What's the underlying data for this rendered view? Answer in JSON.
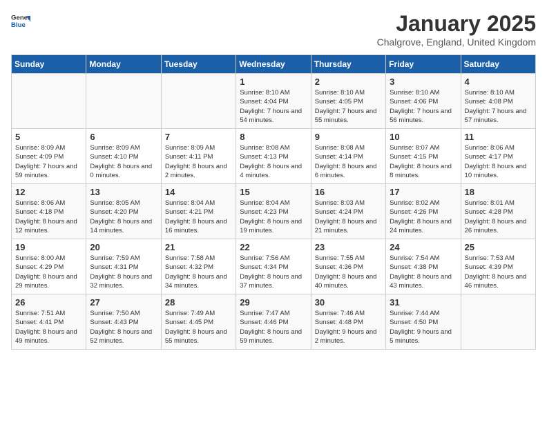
{
  "header": {
    "logo_general": "General",
    "logo_blue": "Blue",
    "month_title": "January 2025",
    "location": "Chalgrove, England, United Kingdom"
  },
  "days_of_week": [
    "Sunday",
    "Monday",
    "Tuesday",
    "Wednesday",
    "Thursday",
    "Friday",
    "Saturday"
  ],
  "weeks": [
    [
      {
        "day": "",
        "info": ""
      },
      {
        "day": "",
        "info": ""
      },
      {
        "day": "",
        "info": ""
      },
      {
        "day": "1",
        "info": "Sunrise: 8:10 AM\nSunset: 4:04 PM\nDaylight: 7 hours\nand 54 minutes."
      },
      {
        "day": "2",
        "info": "Sunrise: 8:10 AM\nSunset: 4:05 PM\nDaylight: 7 hours\nand 55 minutes."
      },
      {
        "day": "3",
        "info": "Sunrise: 8:10 AM\nSunset: 4:06 PM\nDaylight: 7 hours\nand 56 minutes."
      },
      {
        "day": "4",
        "info": "Sunrise: 8:10 AM\nSunset: 4:08 PM\nDaylight: 7 hours\nand 57 minutes."
      }
    ],
    [
      {
        "day": "5",
        "info": "Sunrise: 8:09 AM\nSunset: 4:09 PM\nDaylight: 7 hours\nand 59 minutes."
      },
      {
        "day": "6",
        "info": "Sunrise: 8:09 AM\nSunset: 4:10 PM\nDaylight: 8 hours\nand 0 minutes."
      },
      {
        "day": "7",
        "info": "Sunrise: 8:09 AM\nSunset: 4:11 PM\nDaylight: 8 hours\nand 2 minutes."
      },
      {
        "day": "8",
        "info": "Sunrise: 8:08 AM\nSunset: 4:13 PM\nDaylight: 8 hours\nand 4 minutes."
      },
      {
        "day": "9",
        "info": "Sunrise: 8:08 AM\nSunset: 4:14 PM\nDaylight: 8 hours\nand 6 minutes."
      },
      {
        "day": "10",
        "info": "Sunrise: 8:07 AM\nSunset: 4:15 PM\nDaylight: 8 hours\nand 8 minutes."
      },
      {
        "day": "11",
        "info": "Sunrise: 8:06 AM\nSunset: 4:17 PM\nDaylight: 8 hours\nand 10 minutes."
      }
    ],
    [
      {
        "day": "12",
        "info": "Sunrise: 8:06 AM\nSunset: 4:18 PM\nDaylight: 8 hours\nand 12 minutes."
      },
      {
        "day": "13",
        "info": "Sunrise: 8:05 AM\nSunset: 4:20 PM\nDaylight: 8 hours\nand 14 minutes."
      },
      {
        "day": "14",
        "info": "Sunrise: 8:04 AM\nSunset: 4:21 PM\nDaylight: 8 hours\nand 16 minutes."
      },
      {
        "day": "15",
        "info": "Sunrise: 8:04 AM\nSunset: 4:23 PM\nDaylight: 8 hours\nand 19 minutes."
      },
      {
        "day": "16",
        "info": "Sunrise: 8:03 AM\nSunset: 4:24 PM\nDaylight: 8 hours\nand 21 minutes."
      },
      {
        "day": "17",
        "info": "Sunrise: 8:02 AM\nSunset: 4:26 PM\nDaylight: 8 hours\nand 24 minutes."
      },
      {
        "day": "18",
        "info": "Sunrise: 8:01 AM\nSunset: 4:28 PM\nDaylight: 8 hours\nand 26 minutes."
      }
    ],
    [
      {
        "day": "19",
        "info": "Sunrise: 8:00 AM\nSunset: 4:29 PM\nDaylight: 8 hours\nand 29 minutes."
      },
      {
        "day": "20",
        "info": "Sunrise: 7:59 AM\nSunset: 4:31 PM\nDaylight: 8 hours\nand 32 minutes."
      },
      {
        "day": "21",
        "info": "Sunrise: 7:58 AM\nSunset: 4:32 PM\nDaylight: 8 hours\nand 34 minutes."
      },
      {
        "day": "22",
        "info": "Sunrise: 7:56 AM\nSunset: 4:34 PM\nDaylight: 8 hours\nand 37 minutes."
      },
      {
        "day": "23",
        "info": "Sunrise: 7:55 AM\nSunset: 4:36 PM\nDaylight: 8 hours\nand 40 minutes."
      },
      {
        "day": "24",
        "info": "Sunrise: 7:54 AM\nSunset: 4:38 PM\nDaylight: 8 hours\nand 43 minutes."
      },
      {
        "day": "25",
        "info": "Sunrise: 7:53 AM\nSunset: 4:39 PM\nDaylight: 8 hours\nand 46 minutes."
      }
    ],
    [
      {
        "day": "26",
        "info": "Sunrise: 7:51 AM\nSunset: 4:41 PM\nDaylight: 8 hours\nand 49 minutes."
      },
      {
        "day": "27",
        "info": "Sunrise: 7:50 AM\nSunset: 4:43 PM\nDaylight: 8 hours\nand 52 minutes."
      },
      {
        "day": "28",
        "info": "Sunrise: 7:49 AM\nSunset: 4:45 PM\nDaylight: 8 hours\nand 55 minutes."
      },
      {
        "day": "29",
        "info": "Sunrise: 7:47 AM\nSunset: 4:46 PM\nDaylight: 8 hours\nand 59 minutes."
      },
      {
        "day": "30",
        "info": "Sunrise: 7:46 AM\nSunset: 4:48 PM\nDaylight: 9 hours\nand 2 minutes."
      },
      {
        "day": "31",
        "info": "Sunrise: 7:44 AM\nSunset: 4:50 PM\nDaylight: 9 hours\nand 5 minutes."
      },
      {
        "day": "",
        "info": ""
      }
    ]
  ]
}
